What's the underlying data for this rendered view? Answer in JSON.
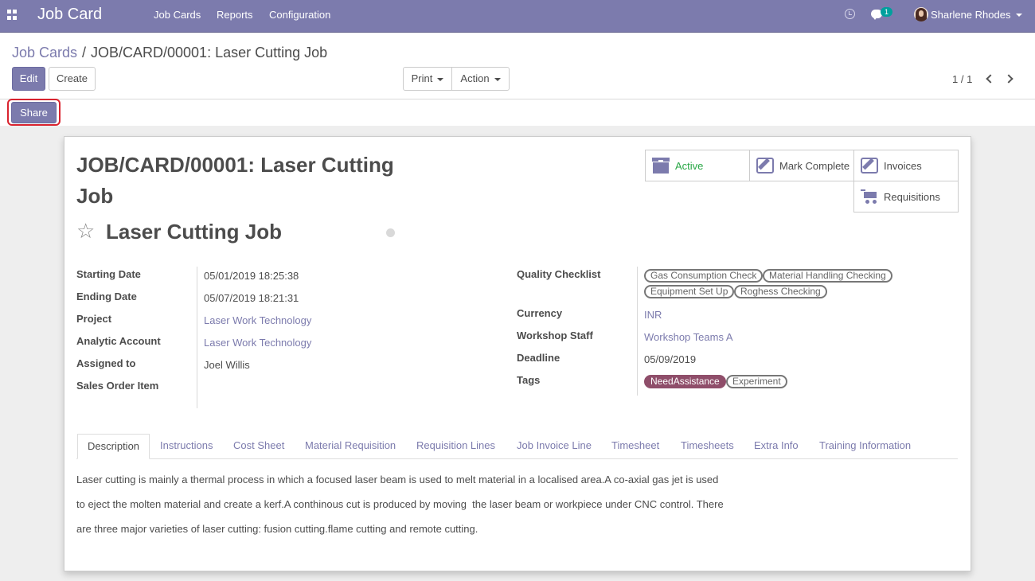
{
  "navbar": {
    "brand": "Job Card",
    "menu": [
      "Job Cards",
      "Reports",
      "Configuration"
    ],
    "chat_count": "1",
    "user_name": "Sharlene Rhodes"
  },
  "breadcrumb": {
    "parent": "Job Cards",
    "separator": "/",
    "current": "JOB/CARD/00001: Laser Cutting Job"
  },
  "toolbar": {
    "edit": "Edit",
    "create": "Create",
    "print": "Print",
    "action": "Action",
    "share": "Share"
  },
  "pager": {
    "value": "1 / 1"
  },
  "smart_buttons": {
    "active": "Active",
    "mark_complete": "Mark Complete",
    "invoices": "Invoices",
    "requisitions": "Requisitions"
  },
  "form": {
    "title_line1": "JOB/CARD/00001: Laser Cutting",
    "title_line2": "Job",
    "name": "Laser Cutting Job",
    "left_fields": [
      {
        "label": "Starting Date",
        "value": "05/01/2019 18:25:38"
      },
      {
        "label": "Ending Date",
        "value": "05/07/2019 18:21:31"
      },
      {
        "label": "Project",
        "value": "Laser Work Technology"
      },
      {
        "label": "Analytic Account",
        "value": "Laser Work Technology"
      },
      {
        "label": "Assigned to",
        "value": "Joel Willis"
      },
      {
        "label": "Sales Order Item",
        "value": ""
      }
    ],
    "right_fields": {
      "quality_checklist_label": "Quality Checklist",
      "quality_checklist": [
        "Gas Consumption Check",
        "Material Handling Checking",
        "Equipment Set Up",
        "Roghess Checking"
      ],
      "currency_label": "Currency",
      "currency": "INR",
      "workshop_staff_label": "Workshop Staff",
      "workshop_staff": "Workshop Teams A",
      "deadline_label": "Deadline",
      "deadline": "05/09/2019",
      "tags_label": "Tags",
      "tags": [
        "NeedAssistance",
        "Experiment"
      ]
    }
  },
  "tabs": [
    "Description",
    "Instructions",
    "Cost Sheet",
    "Material Requisition",
    "Requisition Lines",
    "Job Invoice Line",
    "Timesheet",
    "Timesheets",
    "Extra Info",
    "Training Information"
  ],
  "description": [
    "Laser cutting is mainly a thermal process in which a focused laser beam is used to melt material in a localised area.A co-axial gas jet is used",
    "to eject the molten material and create a kerf.A conthinous cut is produced by moving  the laser beam or workpiece under CNC control. There",
    "are three major varieties of laser cutting: fusion cutting.flame cutting and remote cutting."
  ],
  "colors": {
    "brand": "#7c7bad",
    "active_green": "#28a745",
    "tag_need_assistance": "#8f4e6a",
    "highlight_red": "#d9232f"
  }
}
